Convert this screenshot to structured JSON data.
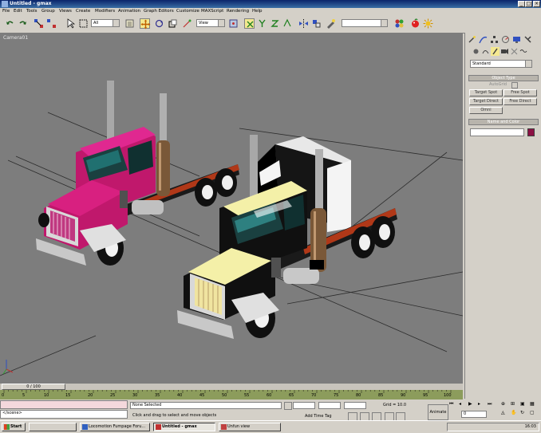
{
  "window": {
    "title": "Untitled - gmax"
  },
  "menu": [
    "File",
    "Edit",
    "Tools",
    "Group",
    "Views",
    "Create",
    "Modifiers",
    "Animation",
    "Graph Editors",
    "Customize",
    "MAXScript",
    "Rendering",
    "Help"
  ],
  "toolbar": {
    "selection_filter": "All",
    "ref_coord": "View",
    "named_selection": ""
  },
  "viewport": {
    "label": "Camera01"
  },
  "command_panel": {
    "category_dropdown": "Standard",
    "object_type": {
      "header": "Object Type",
      "autogrid_label": "AutoGrid",
      "buttons": [
        "Target Spot",
        "Free Spot",
        "Target Direct",
        "Free Direct",
        "Omni"
      ]
    },
    "name_color": {
      "header": "Name and Color",
      "name_value": "",
      "color": "#8c1044"
    }
  },
  "timeline": {
    "frame_label": "0 / 100",
    "ticks": [
      "0",
      "5",
      "10",
      "15",
      "20",
      "25",
      "30",
      "35",
      "40",
      "45",
      "50",
      "55",
      "60",
      "65",
      "70",
      "75",
      "80",
      "85",
      "90",
      "95",
      "100"
    ]
  },
  "status": {
    "listener_top": "",
    "listener_bottom": "</scene>",
    "selection": "None Selected",
    "prompt": "Click and drag to select and move objects",
    "grid": "Grid = 10.0",
    "add_time_tag": "Add Time Tag",
    "animate": "Animate",
    "frame_value": "0"
  },
  "taskbar": {
    "start": "Start",
    "tasks": [
      "Locomotion Fumpage Foru...",
      "Untitled - gmax",
      "Unfun view"
    ],
    "clock": "16:03"
  },
  "colors": {
    "pink_cab": "#c0186c",
    "cream_cab": "#f4f0a8",
    "viewport_bg": "#7d7d7d"
  }
}
